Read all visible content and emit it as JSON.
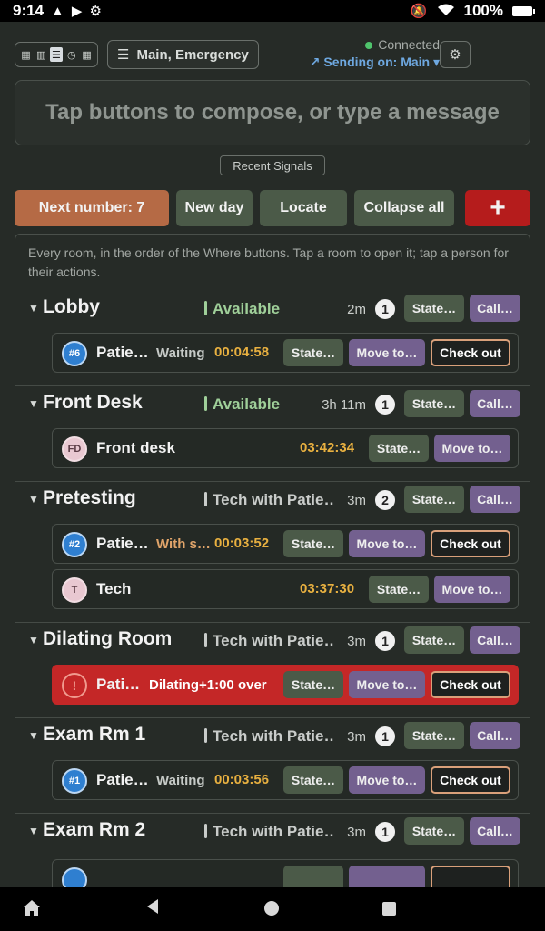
{
  "status_bar": {
    "time": "9:14",
    "battery": "100%",
    "left_icons": [
      "warning-icon",
      "play-icon",
      "settings-icon"
    ],
    "right_icons": [
      "muted-bell-icon",
      "wifi-icon",
      "battery-icon"
    ]
  },
  "header": {
    "channel_label": "Main, Emergency",
    "connection_status": "Connected",
    "sending_on": "Sending on: Main"
  },
  "compose": {
    "placeholder": "Tap buttons to compose, or type a message"
  },
  "recent_signals_label": "Recent Signals",
  "actions": {
    "next_number": "Next number: 7",
    "new_day": "New day",
    "locate": "Locate",
    "collapse_all": "Collapse all",
    "add": "+"
  },
  "intro": "Every room, in the order of the Where buttons. Tap a room to open it; tap a person for their actions.",
  "labels": {
    "state": "State…",
    "call": "Call…",
    "move_to": "Move to…",
    "check_out": "Check out"
  },
  "rooms": [
    {
      "name": "Lobby",
      "status": "Available",
      "time": "2m",
      "count": "1",
      "people": [
        {
          "avatar": "#6",
          "name": "Patie…",
          "state": "Waiting",
          "elapsed": "00:04:58"
        }
      ]
    },
    {
      "name": "Front Desk",
      "status": "Available",
      "time": "3h 11m",
      "count": "1",
      "people": [
        {
          "avatar": "FD",
          "name": "Front desk",
          "state": "",
          "elapsed": "03:42:34"
        }
      ]
    },
    {
      "name": "Pretesting",
      "status": "Tech with Patie…",
      "time": "3m",
      "count": "2",
      "people": [
        {
          "avatar": "#2",
          "name": "Patie…",
          "state": "With s…",
          "elapsed": "00:03:52"
        },
        {
          "avatar": "T",
          "name": "Tech",
          "state": "",
          "elapsed": "03:37:30"
        }
      ]
    },
    {
      "name": "Dilating Room",
      "status": "Tech with Patie…",
      "time": "3m",
      "count": "1",
      "people": [
        {
          "avatar": "!",
          "name": "Pati…",
          "state": "Dilating+1:00 over",
          "elapsed": ""
        }
      ]
    },
    {
      "name": "Exam Rm 1",
      "status": "Tech with Patie…",
      "time": "3m",
      "count": "1",
      "people": [
        {
          "avatar": "#1",
          "name": "Patie…",
          "state": "Waiting",
          "elapsed": "00:03:56"
        }
      ]
    },
    {
      "name": "Exam Rm 2",
      "status": "Tech with Patie…",
      "time": "3m",
      "count": "1",
      "people": []
    }
  ]
}
